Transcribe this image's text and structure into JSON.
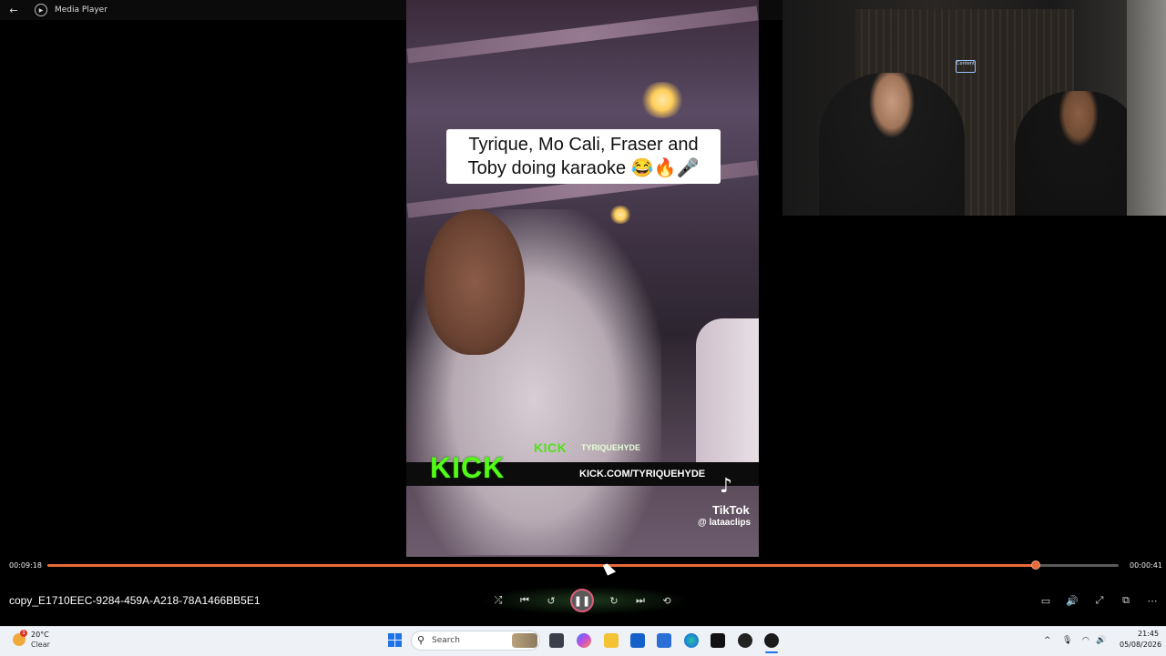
{
  "window": {
    "back_icon": "←",
    "app_icon": "▶",
    "title": "Media Player"
  },
  "video": {
    "caption": "Tyrique, Mo Cali, Fraser and Toby doing karaoke 😂🔥🎤",
    "kick_small_logo": "KICK",
    "kick_small_user": "TYRIQUEHYDE",
    "kick_logo": "KICK",
    "kick_url": "KICK.COM/TYRIQUEHYDE",
    "tiktok_icon": "♪",
    "tiktok_label": "TikTok",
    "tiktok_handle": "@ lataaclips"
  },
  "webcam": {
    "sign_text": "Content"
  },
  "player": {
    "time_elapsed": "00:09:18",
    "time_remaining": "00:00:41",
    "progress_fraction": 0.923,
    "filename": "copy_E1710EEC-9284-459A-A218-78A1466BB5E1",
    "controls": {
      "shuffle_icon": "⤮",
      "previous_icon": "⏮",
      "rewind_icon": "↺",
      "pause_icon": "❚❚",
      "forward_icon": "↻",
      "next_icon": "⏭",
      "repeat_icon": "⟲"
    },
    "right_controls": {
      "miniplayer_icon": "▭",
      "volume_icon": "🔊",
      "fullscreen_icon": "⤢",
      "cast_icon": "⧉",
      "more_icon": "⋯"
    },
    "accent_color": "#e86a3a"
  },
  "taskbar": {
    "weather_badge": "1",
    "weather_temp": "20°C",
    "weather_cond": "Clear",
    "search_icon": "⚲",
    "search_placeholder": "Search",
    "tray_chevron": "^",
    "tray_mic": "🎙",
    "tray_wifi": "◠",
    "tray_volume": "🔊",
    "clock_time": "21:45",
    "clock_date": "05/08/2026"
  }
}
